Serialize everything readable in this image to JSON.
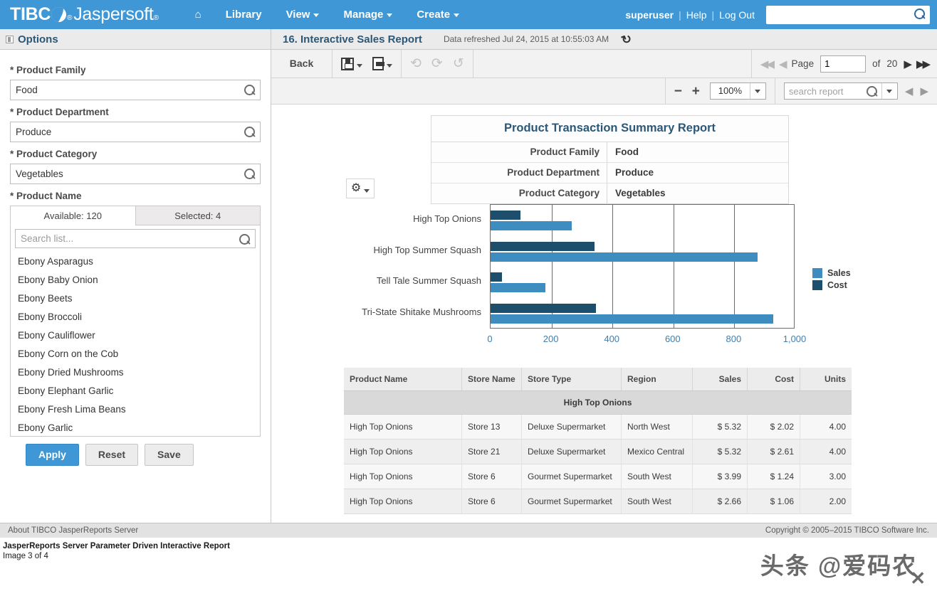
{
  "topbar": {
    "brand_tibco": "TIBC",
    "brand_reg": "®",
    "brand_jasper": "Jaspersoft",
    "brand_tm": "®",
    "nav": [
      {
        "label": "",
        "icon": "home-icon"
      },
      {
        "label": "Library",
        "icon": ""
      },
      {
        "label": "View",
        "icon": "chevron-down-icon"
      },
      {
        "label": "Manage",
        "icon": "chevron-down-icon"
      },
      {
        "label": "Create",
        "icon": "chevron-down-icon"
      }
    ],
    "user": "superuser",
    "help": "Help",
    "logout": "Log Out",
    "search_value": "",
    "search_placeholder": "",
    "accent_color": "#3f97d5"
  },
  "options": {
    "header": "Options",
    "fields": [
      {
        "label": "* Product Family",
        "value": "Food"
      },
      {
        "label": "* Product Department",
        "value": "Produce"
      },
      {
        "label": "* Product Category",
        "value": "Vegetables"
      }
    ],
    "product_name_label": "* Product Name",
    "tab_available": "Available: 120",
    "tab_selected": "Selected: 4",
    "list_search_placeholder": "Search list...",
    "list_search_value": "",
    "items": [
      "Ebony Asparagus",
      "Ebony Baby Onion",
      "Ebony Beets",
      "Ebony Broccoli",
      "Ebony Cauliflower",
      "Ebony Corn on the Cob",
      "Ebony Dried Mushrooms",
      "Ebony Elephant Garlic",
      "Ebony Fresh Lima Beans",
      "Ebony Garlic"
    ],
    "buttons": {
      "apply": "Apply",
      "reset": "Reset",
      "save": "Save"
    }
  },
  "report": {
    "title": "16. Interactive Sales Report",
    "refreshed": "Data refreshed Jul 24, 2015 at 10:55:03 AM",
    "toolbar": {
      "back": "Back",
      "save_icon": "save-icon",
      "export_icon": "export-icon",
      "undo_icon": "undo-icon",
      "redo_icon": "redo-icon",
      "revert_icon": "revert-icon",
      "page_label": "Page",
      "page_value": "1",
      "of_label": "of",
      "page_total": "20",
      "zoom_value": "100%",
      "zoom_out": "−",
      "zoom_in": "+",
      "search_placeholder": "search report",
      "search_value": ""
    },
    "summary": {
      "title": "Product Transaction Summary Report",
      "rows": [
        {
          "key": "Product Family",
          "value": "Food"
        },
        {
          "key": "Product Department",
          "value": "Produce"
        },
        {
          "key": "Product Category",
          "value": "Vegetables"
        }
      ]
    },
    "table": {
      "columns": [
        "Product Name",
        "Store Name",
        "Store Type",
        "Region",
        "Sales",
        "Cost",
        "Units"
      ],
      "group_label": "High Top Onions",
      "rows": [
        {
          "name": "High Top Onions",
          "store": "Store 13",
          "type": "Deluxe Supermarket",
          "region": "North West",
          "sales": "$ 5.32",
          "cost": "$ 2.02",
          "units": "4.00"
        },
        {
          "name": "High Top Onions",
          "store": "Store 21",
          "type": "Deluxe Supermarket",
          "region": "Mexico Central",
          "sales": "$ 5.32",
          "cost": "$ 2.61",
          "units": "4.00"
        },
        {
          "name": "High Top Onions",
          "store": "Store 6",
          "type": "Gourmet Supermarket",
          "region": "South West",
          "sales": "$ 3.99",
          "cost": "$ 1.24",
          "units": "3.00"
        },
        {
          "name": "High Top Onions",
          "store": "Store 6",
          "type": "Gourmet Supermarket",
          "region": "South West",
          "sales": "$ 2.66",
          "cost": "$ 1.06",
          "units": "2.00"
        }
      ]
    }
  },
  "chart_data": {
    "type": "bar",
    "orientation": "horizontal",
    "title": "",
    "categories": [
      "High Top Onions",
      "High Top Summer Squash",
      "Tell Tale Summer Squash",
      "Tri-State Shitake Mushrooms"
    ],
    "series": [
      {
        "name": "Sales",
        "color": "#3e8dc0",
        "values": [
          267,
          876,
          180,
          928
        ]
      },
      {
        "name": "Cost",
        "color": "#1d4e6b",
        "values": [
          99,
          340,
          38,
          345
        ]
      }
    ],
    "xlabel": "",
    "ylabel": "",
    "xlim": [
      0,
      1000
    ],
    "xticks": [
      0,
      200,
      400,
      600,
      800,
      1000
    ],
    "xtick_labels": [
      "0",
      "200",
      "400",
      "600",
      "800",
      "1,000"
    ],
    "grid": true,
    "legend_position": "right"
  },
  "footer": {
    "about": "About TIBCO JasperReports Server",
    "copyright": "Copyright © 2005–2015 TIBCO Software Inc."
  },
  "caption": {
    "line1": "JasperReports Server Parameter Driven Interactive Report",
    "line2": "Image 3 of 4"
  },
  "watermark": {
    "text": "头条 @爱码农",
    "close": "✕"
  }
}
